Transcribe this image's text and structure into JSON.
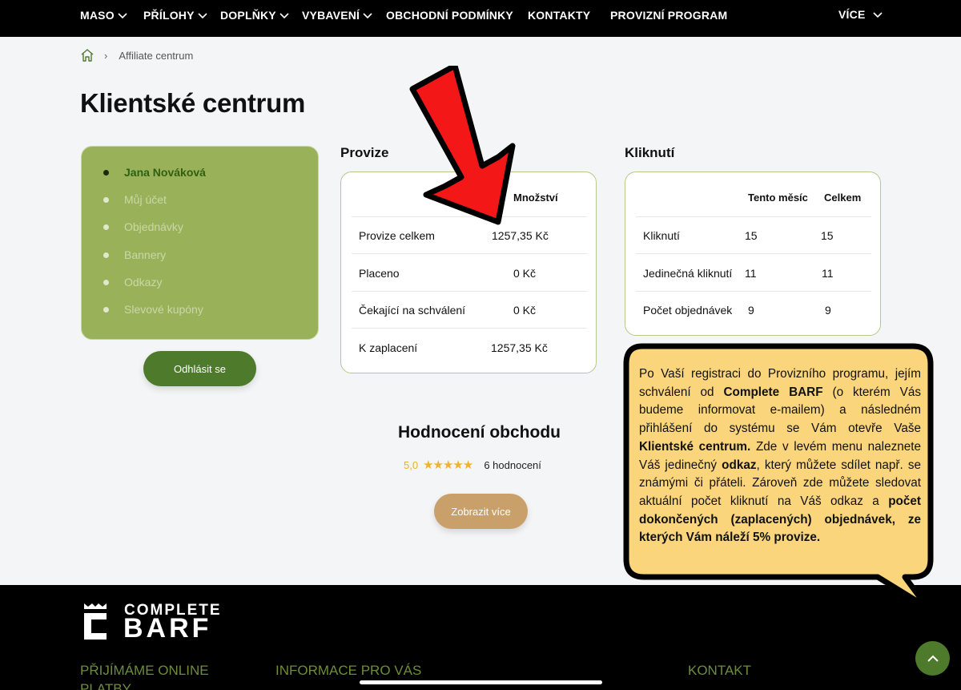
{
  "nav": {
    "items": [
      {
        "label": "MASO",
        "dropdown": true
      },
      {
        "label": "PŘÍLOHY",
        "dropdown": true
      },
      {
        "label": "DOPLŇKY",
        "dropdown": true
      },
      {
        "label": "VYBAVENÍ",
        "dropdown": true
      },
      {
        "label": "OBCHODNÍ PODMÍNKY",
        "dropdown": false
      },
      {
        "label": "KONTAKTY",
        "dropdown": false
      },
      {
        "label": "PROVIZNÍ PROGRAM",
        "dropdown": false
      }
    ],
    "more_label": "VÍCE"
  },
  "breadcrumb": {
    "current": "Affiliate centrum"
  },
  "page_title": "Klientské centrum",
  "sidebar": {
    "items": [
      {
        "label": "Jana Nováková",
        "active": true
      },
      {
        "label": "Můj účet",
        "active": false
      },
      {
        "label": "Objednávky",
        "active": false
      },
      {
        "label": "Bannery",
        "active": false
      },
      {
        "label": "Odkazy",
        "active": false
      },
      {
        "label": "Slevové kupóny",
        "active": false
      }
    ],
    "logout_label": "Odhlásit se"
  },
  "provize": {
    "heading": "Provize",
    "column_header": "Množství",
    "rows": [
      {
        "label": "Provize celkem",
        "value": "1257,35 Kč"
      },
      {
        "label": "Placeno",
        "value": "0 Kč"
      },
      {
        "label": "Čekající na schválení",
        "value": "0 Kč"
      },
      {
        "label": "K zaplacení",
        "value": "1257,35 Kč"
      }
    ]
  },
  "kliknuti": {
    "heading": "Kliknutí",
    "column_headers": [
      "Tento měsíc",
      "Celkem"
    ],
    "rows": [
      {
        "label": "Kliknutí",
        "month": "15",
        "total": "15"
      },
      {
        "label": "Jedinečná kliknutí",
        "month": "11",
        "total": "11"
      },
      {
        "label": "Počet objednávek",
        "month": "9",
        "total": "9"
      }
    ]
  },
  "rating": {
    "title": "Hodnocení obchodu",
    "score": "5,0",
    "stars": "★★★★★",
    "count": "6 hodnocení",
    "more_label": "Zobrazit více"
  },
  "callout": {
    "p1": "Po Vaší registraci do Provizního programu, jejím schválení od ",
    "b1": "Complete BARF",
    "p2": " (o kterém Vás budeme informovat e-mailem) a následném přihlášení do systému se Vám otevře Vaše ",
    "b2": "Klientské centrum.",
    "p3": " Zde v levém menu naleznete Váš jedinečný ",
    "b3": "odkaz",
    "p4": ", který můžete sdílet např. se známými či přáteli. Zároveň zde můžete sledovat aktuální počet kliknutí na Váš odkaz a ",
    "b4": "počet dokončených (zaplacených) objednávek, ze kterých Vám náleží 5% provize."
  },
  "footer": {
    "logo_line1": "COMPLETE",
    "logo_line2": "BARF",
    "col1": "PŘIJÍMÁME ONLINE",
    "col1b": "PLATBY",
    "col2": "INFORMACE PRO VÁS",
    "col3": "KONTAKT"
  },
  "colors": {
    "accent_green": "#4e7a2c",
    "sidebar_green": "#99b25a",
    "callout_yellow": "#fbd57c",
    "arrow_red": "#f41717",
    "button_tan": "#c9a069"
  }
}
